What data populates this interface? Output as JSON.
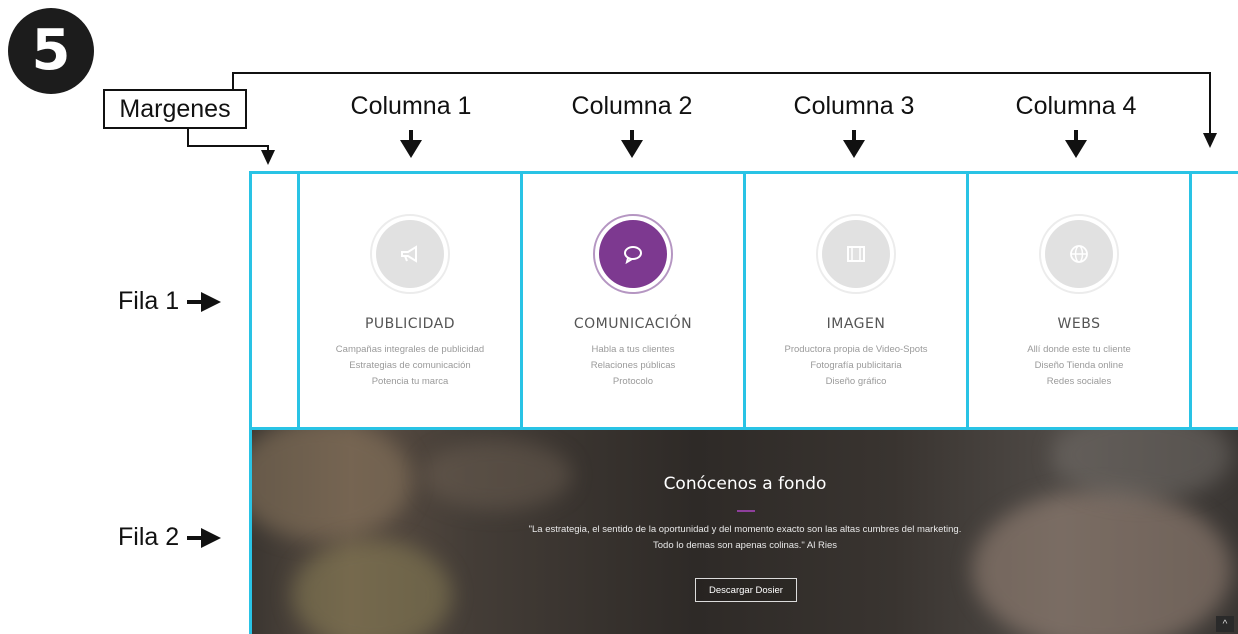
{
  "step_number": "5",
  "annotations": {
    "margins_label": "Margenes",
    "columns": [
      "Columna 1",
      "Columna 2",
      "Columna 3",
      "Columna 4"
    ],
    "rows": [
      "Fila 1",
      "Fila 2"
    ],
    "row_arrow_icon": "arrow-right-icon",
    "grid_line_color": "#29c3e5"
  },
  "services": [
    {
      "icon": "megaphone-icon",
      "title": "PUBLICIDAD",
      "lines": [
        "Campañas integrales de publicidad",
        "Estrategias de comunicación",
        "Potencia tu marca"
      ],
      "active": false
    },
    {
      "icon": "chat-bubble-icon",
      "title": "COMUNICACIÓN",
      "lines": [
        "Habla a tus clientes",
        "Relaciones públicas",
        "Protocolo"
      ],
      "active": true
    },
    {
      "icon": "film-icon",
      "title": "IMAGEN",
      "lines": [
        "Productora propia de Video-Spots",
        "Fotografía publicitaria",
        "Diseño gráfico"
      ],
      "active": false
    },
    {
      "icon": "globe-icon",
      "title": "WEBS",
      "lines": [
        "Allí donde este tu cliente",
        "Diseño Tienda online",
        "Redes sociales"
      ],
      "active": false
    }
  ],
  "hero": {
    "title": "Conócenos a fondo",
    "quote_line1": "\"La estrategia, el sentido de la oportunidad y del momento exacto son las altas cumbres del marketing.",
    "quote_line2": "Todo lo demas son apenas colinas.\" Al Ries",
    "button_label": "Descargar Dosier",
    "accent_color": "#8e3f9c"
  },
  "scroll_top_icon": "^"
}
